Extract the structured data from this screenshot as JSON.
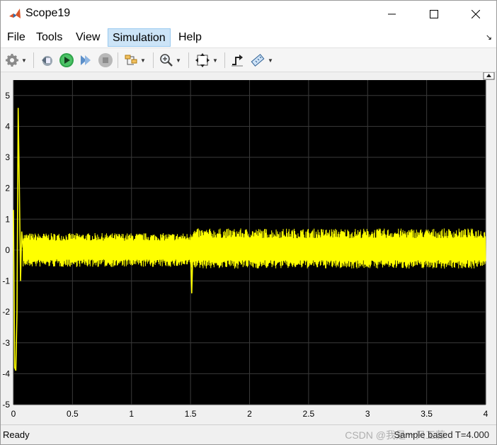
{
  "window": {
    "title": "Scope19",
    "icon": "matlab-icon",
    "controls": [
      "minimize-icon",
      "maximize-icon",
      "close-icon"
    ]
  },
  "menu": {
    "items": [
      "File",
      "Tools",
      "View",
      "Simulation",
      "Help"
    ],
    "active": "Simulation"
  },
  "toolbar": {
    "icons": [
      "gear-icon",
      "step-back-icon",
      "run-icon",
      "step-forward-icon",
      "stop-icon",
      "signal-icon",
      "zoom-icon",
      "autoscale-icon",
      "triggers-icon",
      "measurements-icon"
    ]
  },
  "status": {
    "left": "Ready",
    "right": "Sample based   T=4.000",
    "watermark": "CSDN @我是一只工藤"
  },
  "colors": {
    "plot_background": "#000000",
    "trace": "#ffff00",
    "grid": "#3a3a3a"
  },
  "chart_data": {
    "type": "line",
    "title": "",
    "xlabel": "",
    "ylabel": "",
    "xlim": [
      0,
      4
    ],
    "ylim": [
      -5,
      5.5
    ],
    "x_ticks": [
      "0",
      "0.5",
      "1",
      "1.5",
      "2",
      "2.5",
      "3",
      "3.5",
      "4"
    ],
    "y_ticks": [
      "5",
      "4",
      "3",
      "2",
      "1",
      "0",
      "-1",
      "-2",
      "-3",
      "-4",
      "-5"
    ],
    "grid": true,
    "series": [
      {
        "color": "#ffff00",
        "x": [
          0.0,
          0.01,
          0.02,
          0.03,
          0.04,
          0.05,
          0.06,
          0.07,
          0.08,
          0.1,
          0.3,
          0.5,
          0.8,
          1.0,
          1.3,
          1.5,
          1.51,
          1.52,
          1.55,
          1.6,
          2.0,
          2.5,
          3.0,
          3.5,
          4.0
        ],
        "y": [
          1.3,
          -3.8,
          -3.9,
          -2.0,
          4.6,
          2.0,
          -1.0,
          0.6,
          0.1,
          0.1,
          0.1,
          0.1,
          0.1,
          0.1,
          0.1,
          0.1,
          -1.4,
          0.0,
          0.15,
          0.15,
          0.15,
          0.15,
          0.15,
          0.1,
          0.1
        ],
        "noise_band": [
          {
            "x_from": 0.08,
            "x_to": 1.5,
            "low": -0.55,
            "high": 0.55
          },
          {
            "x_from": 1.5,
            "x_to": 4.0,
            "low": -0.6,
            "high": 0.7
          }
        ]
      }
    ]
  }
}
